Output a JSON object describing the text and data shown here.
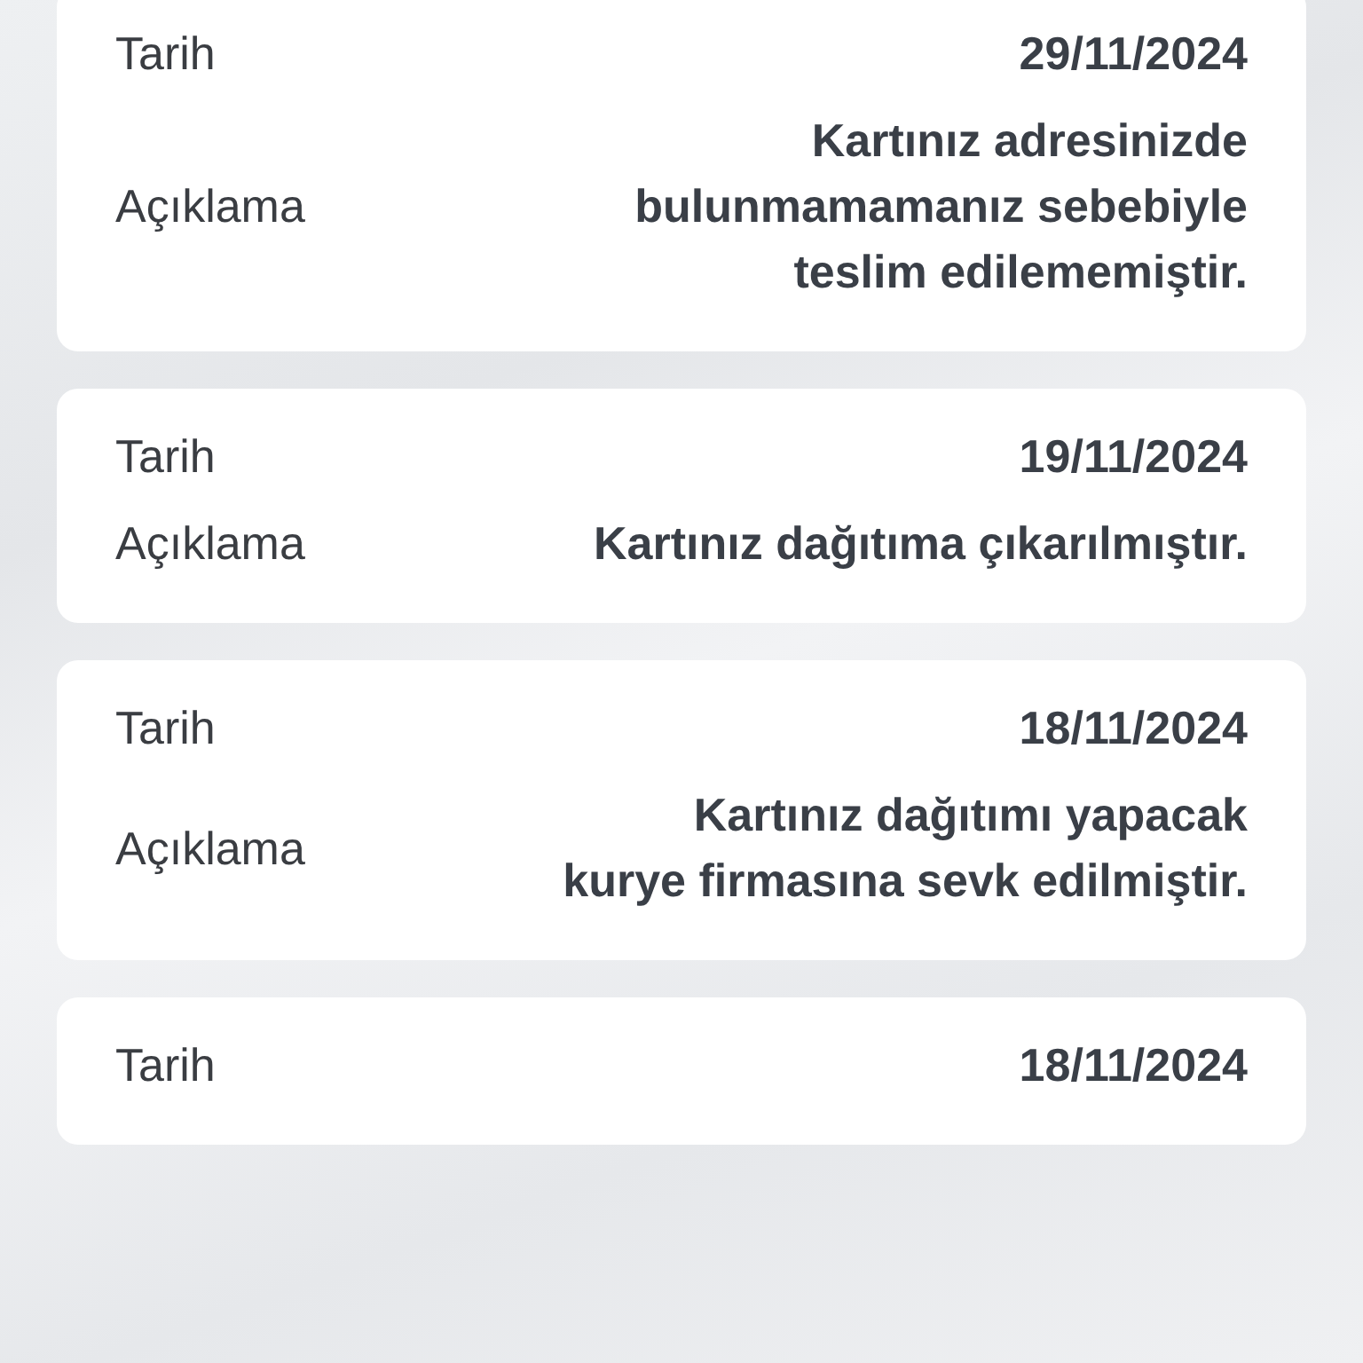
{
  "cards": [
    {
      "rows": [
        {
          "label": "Tarih",
          "value": "29/11/2024"
        },
        {
          "label": "Açıklama",
          "value": "Kartınız adresinizde\nbulunmamamanız sebebiyle\nteslim edilememiştir."
        }
      ]
    },
    {
      "rows": [
        {
          "label": "Tarih",
          "value": "19/11/2024"
        },
        {
          "label": "Açıklama",
          "value": "Kartınız dağıtıma çıkarılmıştır."
        }
      ]
    },
    {
      "rows": [
        {
          "label": "Tarih",
          "value": "18/11/2024"
        },
        {
          "label": "Açıklama",
          "value": "Kartınız dağıtımı yapacak\nkurye firmasına sevk edilmiştir."
        }
      ]
    },
    {
      "rows": [
        {
          "label": "Tarih",
          "value": "18/11/2024"
        }
      ]
    }
  ]
}
